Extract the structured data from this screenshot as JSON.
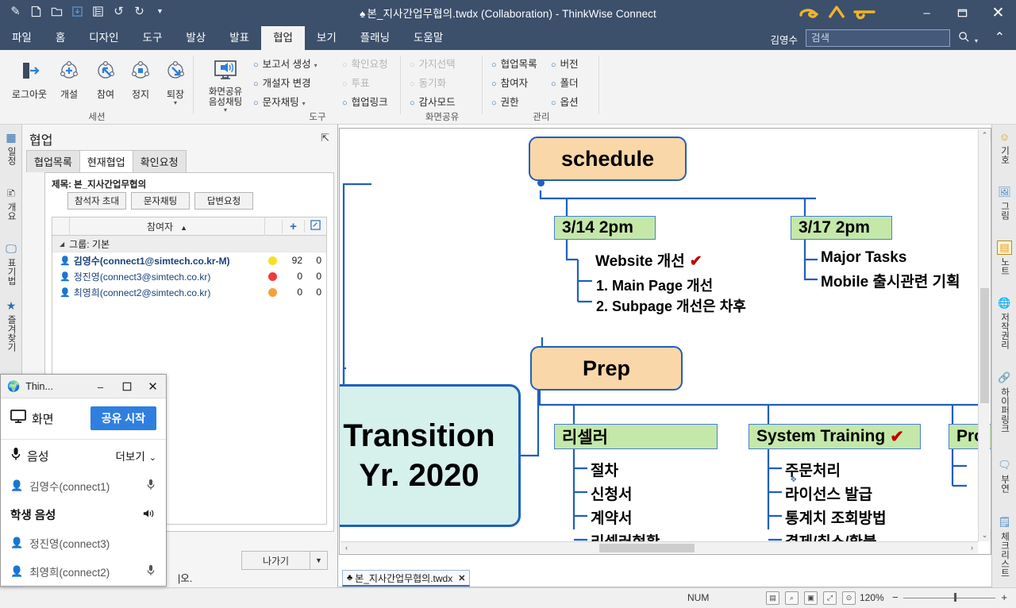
{
  "titlebar": {
    "title": "본_지사간업무협의.twdx (Collaboration) - ThinkWise Connect",
    "suit_glyph": "♠",
    "quick_access": [
      {
        "name": "brush-icon",
        "glyph": "✎"
      },
      {
        "name": "new-document-icon",
        "glyph": "🗋"
      },
      {
        "name": "open-folder-icon",
        "glyph": "🗀"
      },
      {
        "name": "save-icon",
        "glyph": "⤓"
      },
      {
        "name": "print-icon",
        "glyph": "🖳"
      },
      {
        "name": "undo-icon",
        "glyph": "↺"
      },
      {
        "name": "redo-icon",
        "glyph": "↻"
      },
      {
        "name": "customize-dropdown-icon",
        "glyph": "▼"
      }
    ],
    "minimize": "–",
    "maximize": "❐",
    "close": "✕"
  },
  "menubar": {
    "items": [
      {
        "label": "파일",
        "active": false
      },
      {
        "label": "홈",
        "active": false
      },
      {
        "label": "디자인",
        "active": false
      },
      {
        "label": "도구",
        "active": false
      },
      {
        "label": "발상",
        "active": false
      },
      {
        "label": "발표",
        "active": false
      },
      {
        "label": "협업",
        "active": true
      },
      {
        "label": "보기",
        "active": false
      },
      {
        "label": "플래닝",
        "active": false
      },
      {
        "label": "도움말",
        "active": false
      }
    ],
    "user_name": "김영수",
    "search_placeholder": "검색",
    "search_value": "검색",
    "search_icon": "search-icon",
    "collapse_icon": "chevron-up-icon"
  },
  "ribbon": {
    "groups": [
      {
        "name": "session",
        "label": "세션",
        "big_buttons": [
          {
            "label": "로그아웃",
            "icon": "logout-icon"
          },
          {
            "label": "개설",
            "icon": "create-session-icon"
          },
          {
            "label": "참여",
            "icon": "join-session-icon"
          },
          {
            "label": "정지",
            "icon": "stop-session-icon"
          },
          {
            "label": "퇴장",
            "icon": "leave-session-icon",
            "has_dropdown": true
          }
        ]
      },
      {
        "name": "tools",
        "label": "도구",
        "big_buttons": [
          {
            "label": "화면공유\n음성채팅",
            "icon": "screen-share-icon"
          }
        ],
        "items_col1": [
          {
            "label": "보고서 생성",
            "dropdown": true,
            "disabled": false
          },
          {
            "label": "개설자 변경",
            "dropdown": false,
            "disabled": false
          },
          {
            "label": "문자채팅",
            "dropdown": true,
            "disabled": false
          }
        ],
        "items_col2": [
          {
            "label": "확인요청",
            "dropdown": false,
            "disabled": true
          },
          {
            "label": "투표",
            "dropdown": false,
            "disabled": true
          },
          {
            "label": "협업링크",
            "dropdown": false,
            "disabled": false
          }
        ]
      },
      {
        "name": "screen-share",
        "label": "화면공유",
        "items_col1": [
          {
            "label": "가지선택",
            "disabled": true
          },
          {
            "label": "동기화",
            "disabled": true
          },
          {
            "label": "감사모드",
            "disabled": false
          }
        ]
      },
      {
        "name": "management",
        "label": "관리",
        "items_col1": [
          {
            "label": "협업목록",
            "disabled": false
          },
          {
            "label": "참여자",
            "disabled": false
          },
          {
            "label": "권한",
            "disabled": false
          }
        ],
        "items_col2": [
          {
            "label": "버전",
            "disabled": false
          },
          {
            "label": "폴더",
            "disabled": false
          },
          {
            "label": "옵션",
            "disabled": false
          }
        ]
      }
    ]
  },
  "left_strip": [
    {
      "label": "일정",
      "icon": "calendar-icon",
      "glyph": "▦",
      "color": "#2d6fb5"
    },
    {
      "label": "개요",
      "icon": "outline-icon",
      "glyph": "🗈",
      "color": "#333333"
    },
    {
      "label": "표기법",
      "icon": "presentation-icon",
      "glyph": "🖵",
      "color": "#2d6fb5"
    },
    {
      "label": "즐겨찾기",
      "icon": "star-icon",
      "glyph": "★",
      "color": "#2d6fb5"
    }
  ],
  "collab_panel": {
    "title": "협업",
    "pin_icon": "pin-icon",
    "tabs": [
      {
        "label": "협업목록",
        "active": false
      },
      {
        "label": "현재협업",
        "active": true
      },
      {
        "label": "확인요청",
        "active": false
      }
    ],
    "subject": "제목: 본_지사간업무협의",
    "buttons": [
      {
        "label": "참석자 초대"
      },
      {
        "label": "문자채팅"
      },
      {
        "label": "답변요청"
      }
    ],
    "grid": {
      "header": "참여자",
      "sort_arrow": "▲",
      "add_icon": "plus-icon",
      "edit_icon": "edit-icon",
      "group_row": "그룹: 기본",
      "rows": [
        {
          "name": "김영수(connect1@simtech.co.kr-M)",
          "status_color": "#f5e020",
          "count1": "92",
          "count2": "0",
          "bold": true
        },
        {
          "name": "정진영(connect3@simtech.co.kr)",
          "status_color": "#ef3b3b",
          "count1": "0",
          "count2": "0",
          "bold": false
        },
        {
          "name": "최영희(connect2@simtech.co.kr)",
          "status_color": "#f7a13c",
          "count1": "0",
          "count2": "0",
          "bold": false
        }
      ]
    },
    "exit_button": "나가기",
    "exit_caret": "▼",
    "bottom_text": "|오."
  },
  "dialog": {
    "icon": "app-globe-icon",
    "title": "Thin...",
    "minimize": "–",
    "maximize": "❐",
    "close": "✕",
    "screen_label": "화면",
    "screen_icon": "monitor-icon",
    "share_button": "공유 시작",
    "voice_label": "음성",
    "voice_icon": "microphone-icon",
    "more_label": "더보기",
    "more_caret": "⌄",
    "rows": [
      {
        "name": "김영수(connect1)",
        "icon": "person-icon",
        "icon_color": "blue",
        "right_icon": "microphone-icon",
        "bold": false
      },
      {
        "name": "학생 음성",
        "icon": "",
        "icon_color": "",
        "right_icon": "speaker-icon",
        "bold": true
      },
      {
        "name": "정진영(connect3)",
        "icon": "person-icon",
        "icon_color": "gray",
        "right_icon": "",
        "bold": false
      },
      {
        "name": "최영희(connect2)",
        "icon": "person-icon",
        "icon_color": "blue",
        "right_icon": "microphone-icon",
        "bold": false
      }
    ]
  },
  "mindmap": {
    "root": {
      "line1": "Transition",
      "line2": "Yr. 2020"
    },
    "branches": [
      {
        "title": "schedule",
        "children": [
          {
            "title": "3/14 2pm",
            "items": [
              {
                "text": "Website 개선",
                "check": true,
                "subitems": [
                  "1. Main Page 개선",
                  "2. Subpage 개선은 차후"
                ]
              }
            ]
          },
          {
            "title": "3/17 2pm",
            "items": [
              {
                "text": "Major Tasks",
                "check": false,
                "subitems": []
              },
              {
                "text": "Mobile 출시관련 기획",
                "check": false,
                "subitems": []
              }
            ]
          }
        ]
      },
      {
        "title": "Prep",
        "children": [
          {
            "title": "리셀러",
            "items": [
              {
                "text": "절차",
                "check": false,
                "subitems": []
              },
              {
                "text": "신청서",
                "check": false,
                "subitems": []
              },
              {
                "text": "계약서",
                "check": false,
                "subitems": []
              },
              {
                "text": "리셀러현황",
                "check": false,
                "subitems": []
              }
            ]
          },
          {
            "title": "System Training",
            "check": true,
            "items": [
              {
                "text": "주문처리",
                "check": false,
                "subitems": []
              },
              {
                "text": "라이선스 발급",
                "check": false,
                "subitems": []
              },
              {
                "text": "통계치 조회방법",
                "check": false,
                "subitems": []
              },
              {
                "text": "결제/취소/환불",
                "check": false,
                "subitems": []
              }
            ]
          },
          {
            "title": "Pro",
            "check": false,
            "items": []
          }
        ]
      }
    ],
    "check_glyph": "✔",
    "colors": {
      "root_fill": "#d6f0ec",
      "orange_fill": "#fad7a8",
      "green_fill": "#c4e8a8",
      "line": "#1f5fbf",
      "check": "#c00000"
    }
  },
  "right_strip": [
    {
      "label": "기호",
      "icon": "smiley-icon",
      "glyph": "☺",
      "color": "#e09a10"
    },
    {
      "label": "그림",
      "icon": "picture-icon",
      "glyph": "🖼",
      "color": "#4a87c8"
    },
    {
      "label": "노트",
      "icon": "note-icon",
      "glyph": "▤",
      "color": "#e0a020"
    },
    {
      "label": "저작권리",
      "icon": "globe-icon",
      "glyph": "🌐",
      "color": "#2d6fb5"
    },
    {
      "label": "하이퍼링크",
      "icon": "link-icon",
      "glyph": "🔗",
      "color": "#4a87c8"
    },
    {
      "label": "부연",
      "icon": "comment-icon",
      "glyph": "🗨",
      "color": "#4a87c8"
    },
    {
      "label": "체크리스트",
      "icon": "checklist-icon",
      "glyph": "🗒",
      "color": "#4a87c8"
    }
  ],
  "doc_tab": {
    "suit": "♣",
    "label": "본_지사간업무협의.twdx",
    "close": "✕"
  },
  "statusbar": {
    "num_lock": "NUM",
    "view_icons": [
      {
        "name": "outline-view-icon",
        "glyph": "⊞"
      },
      {
        "name": "zoom-out-view-icon",
        "glyph": "⌕"
      },
      {
        "name": "screen-fit-icon",
        "glyph": "▣"
      },
      {
        "name": "fit-page-icon",
        "glyph": "⤢"
      },
      {
        "name": "zoom-100-icon",
        "glyph": "⊙"
      }
    ],
    "zoom_level": "120%",
    "zoom_minus": "−",
    "zoom_plus": "+"
  }
}
